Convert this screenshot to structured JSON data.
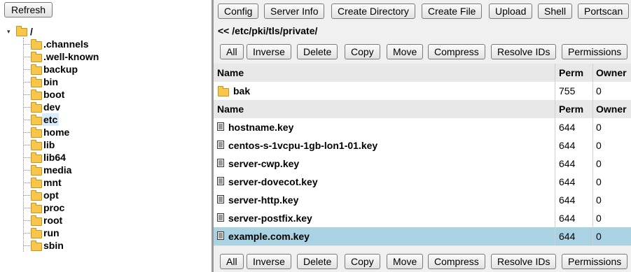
{
  "left": {
    "refresh_label": "Refresh",
    "tree": {
      "root_label": "/",
      "items": [
        {
          "label": ".channels"
        },
        {
          "label": ".well-known"
        },
        {
          "label": "backup"
        },
        {
          "label": "bin"
        },
        {
          "label": "boot"
        },
        {
          "label": "dev"
        },
        {
          "label": "etc",
          "selected": true
        },
        {
          "label": "home"
        },
        {
          "label": "lib"
        },
        {
          "label": "lib64"
        },
        {
          "label": "media"
        },
        {
          "label": "mnt"
        },
        {
          "label": "opt"
        },
        {
          "label": "proc"
        },
        {
          "label": "root"
        },
        {
          "label": "run"
        },
        {
          "label": "sbin"
        }
      ]
    }
  },
  "toolbar": {
    "config": "Config",
    "server_info": "Server Info",
    "create_directory": "Create Directory",
    "create_file": "Create File",
    "upload": "Upload",
    "shell": "Shell",
    "portscan": "Portscan"
  },
  "path": "<< /etc/pki/tls/private/",
  "actions": {
    "all": "All",
    "inverse": "Inverse",
    "delete": "Delete",
    "copy": "Copy",
    "move": "Move",
    "compress": "Compress",
    "resolve_ids": "Resolve IDs",
    "permissions": "Permissions"
  },
  "table": {
    "headers": {
      "name": "Name",
      "perm": "Perm",
      "owner": "Owner"
    },
    "directories": [
      {
        "name": "bak",
        "perm": "755",
        "owner": "0"
      }
    ],
    "files": [
      {
        "name": "hostname.key",
        "perm": "644",
        "owner": "0"
      },
      {
        "name": "centos-s-1vcpu-1gb-lon1-01.key",
        "perm": "644",
        "owner": "0"
      },
      {
        "name": "server-cwp.key",
        "perm": "644",
        "owner": "0"
      },
      {
        "name": "server-dovecot.key",
        "perm": "644",
        "owner": "0"
      },
      {
        "name": "server-http.key",
        "perm": "644",
        "owner": "0"
      },
      {
        "name": "server-postfix.key",
        "perm": "644",
        "owner": "0"
      },
      {
        "name": "example.com.key",
        "perm": "644",
        "owner": "0",
        "selected": true
      }
    ]
  },
  "colors": {
    "selected_row": "#a9d3e3",
    "selected_tree": "#d9ecfb",
    "folder": "#f7c64b"
  }
}
